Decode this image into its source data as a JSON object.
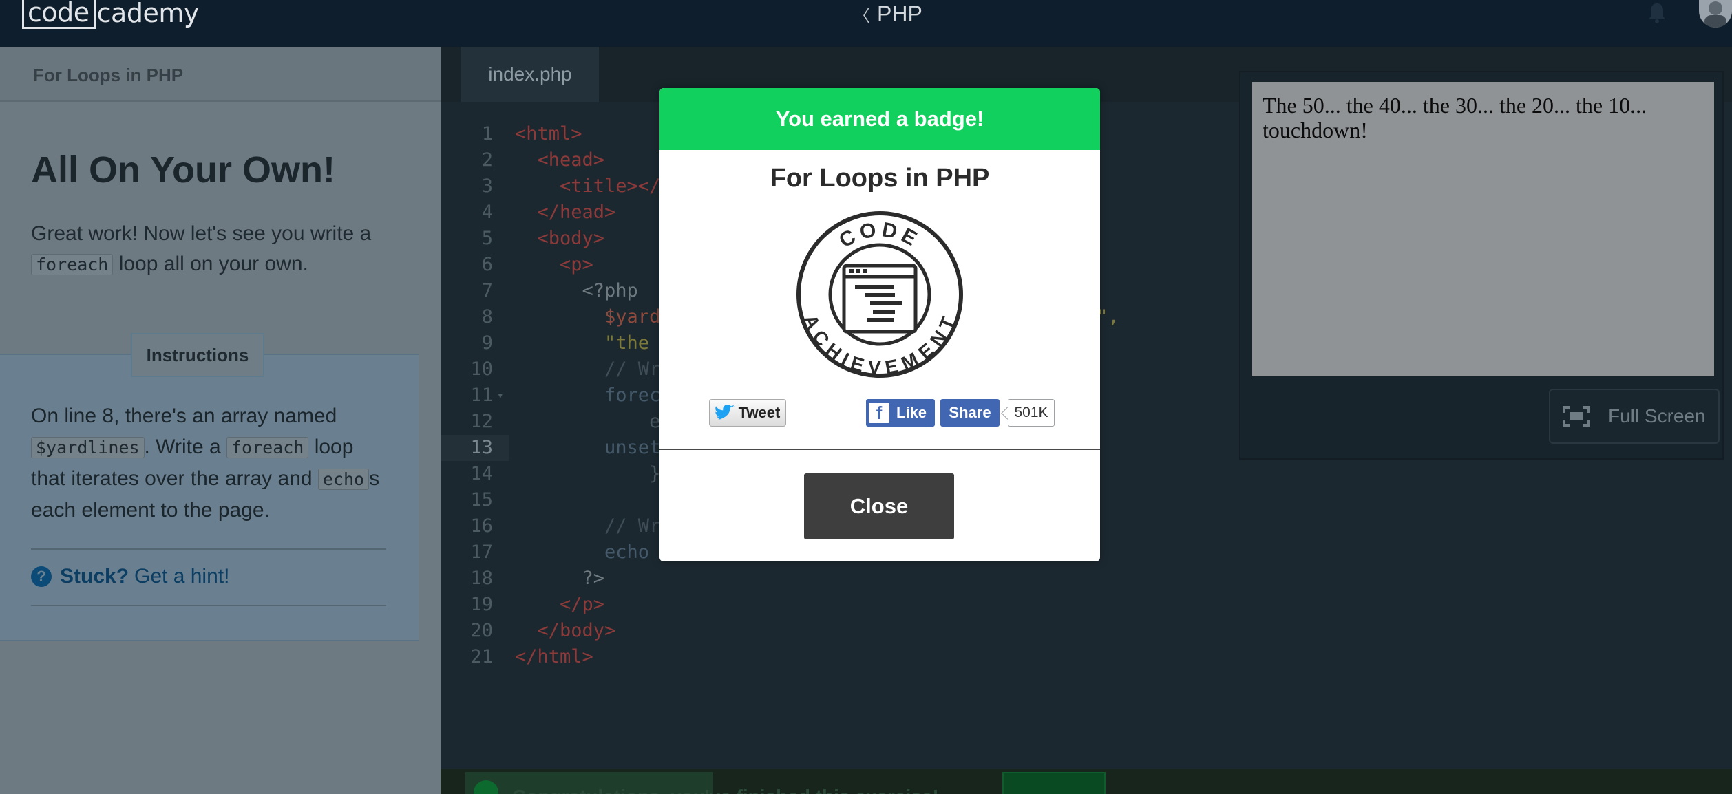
{
  "topbar": {
    "logo_left": "code",
    "logo_right": "cademy",
    "course_chevron": "〈",
    "course": "PHP",
    "icons": {
      "notifications": "bell-icon",
      "profile": "avatar"
    }
  },
  "lesson": {
    "header": "For Loops in PHP",
    "title": "All On Your Own!",
    "intro": {
      "pre": "Great work! Now let's see you write a",
      "code": "foreach",
      "post": "loop all on your own."
    },
    "instructions_label": "Instructions",
    "instructions": {
      "p1": "On line 8, there's an array named",
      "code1": "$yardlines",
      "p2": ". Write a",
      "code2": "foreach",
      "p3": "loop that iterates over the array and",
      "code3": "echo",
      "p4": "s each element to the page."
    },
    "hint": {
      "icon": "?",
      "stuck": "Stuck?",
      "link": "Get a hint!"
    }
  },
  "editor": {
    "tab": "index.php",
    "active_line": 13,
    "lines": [
      {
        "n": "1",
        "segs": [
          {
            "c": "t-tag",
            "t": "<html>"
          }
        ]
      },
      {
        "n": "2",
        "segs": [
          {
            "c": "t-tag",
            "t": "  <head>"
          }
        ]
      },
      {
        "n": "3",
        "segs": [
          {
            "c": "t-tag",
            "t": "    <title></"
          }
        ]
      },
      {
        "n": "4",
        "segs": [
          {
            "c": "t-tag",
            "t": "  </head>"
          }
        ]
      },
      {
        "n": "5",
        "segs": [
          {
            "c": "t-tag",
            "t": "  <body>"
          }
        ]
      },
      {
        "n": "6",
        "segs": [
          {
            "c": "t-tag",
            "t": "    <p>"
          }
        ]
      },
      {
        "n": "7",
        "segs": [
          {
            "c": "t-php",
            "t": "      <?php"
          }
        ]
      },
      {
        "n": "8",
        "segs": [
          {
            "c": "t-var",
            "t": "        $yard"
          },
          {
            "c": "t-str",
            "t": "                                       \","
          }
        ]
      },
      {
        "n": "9",
        "segs": [
          {
            "c": "t-str",
            "t": "        \"the "
          }
        ]
      },
      {
        "n": "10",
        "segs": [
          {
            "c": "t-com",
            "t": "        // Wr"
          }
        ]
      },
      {
        "n": "11",
        "segs": [
          {
            "c": "t-kw",
            "t": "        forec"
          }
        ]
      },
      {
        "n": "12",
        "segs": [
          {
            "c": "t-plain",
            "t": "            e"
          }
        ]
      },
      {
        "n": "13",
        "segs": [
          {
            "c": "t-kw",
            "t": "        unset"
          }
        ]
      },
      {
        "n": "14",
        "segs": [
          {
            "c": "t-plain",
            "t": "            }"
          }
        ]
      },
      {
        "n": "15",
        "segs": [
          {
            "c": "t-plain",
            "t": ""
          }
        ]
      },
      {
        "n": "16",
        "segs": [
          {
            "c": "t-com",
            "t": "        // Wr"
          }
        ]
      },
      {
        "n": "17",
        "segs": [
          {
            "c": "t-kw",
            "t": "        echo"
          },
          {
            "c": "t-plain",
            "t": "             ;"
          }
        ]
      },
      {
        "n": "18",
        "segs": [
          {
            "c": "t-php",
            "t": "      ?>"
          }
        ]
      },
      {
        "n": "19",
        "segs": [
          {
            "c": "t-tag",
            "t": "    </p>"
          }
        ]
      },
      {
        "n": "20",
        "segs": [
          {
            "c": "t-tag",
            "t": "  </body>"
          }
        ]
      },
      {
        "n": "21",
        "segs": [
          {
            "c": "t-tag",
            "t": "</html>"
          }
        ]
      }
    ]
  },
  "output": {
    "text": "The 50... the 40... the 30... the 20... the 10... touchdown!",
    "fullscreen": "Full Screen"
  },
  "bottombar": {
    "message": "Congratulations, you've finished this exercise!"
  },
  "modal": {
    "header": "You earned a badge!",
    "title": "For Loops in PHP",
    "badge_top_text": "CODE",
    "badge_bottom_text": "ACHIEVEMENT",
    "tweet": "Tweet",
    "like": "Like",
    "share": "Share",
    "like_count": "501K",
    "close": "Close",
    "colors": {
      "header": "#12d05e",
      "close": "#3e3e3e",
      "facebook": "#4267b2"
    }
  }
}
